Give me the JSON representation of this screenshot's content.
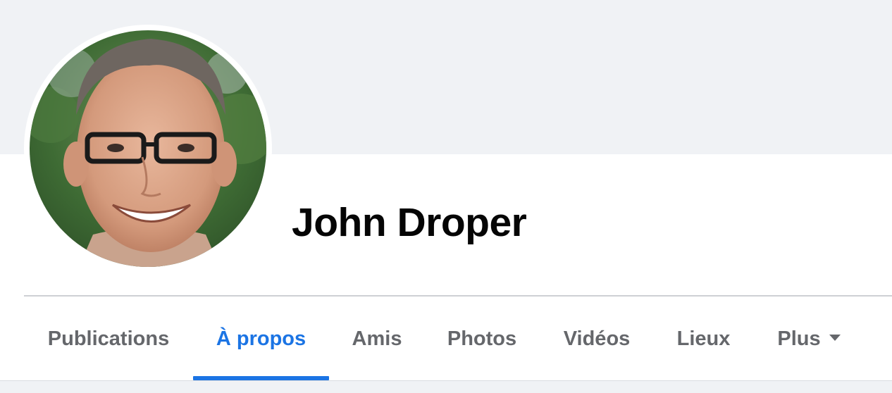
{
  "profile": {
    "name": "John Droper"
  },
  "tabs": [
    {
      "label": "Publications",
      "active": false
    },
    {
      "label": "À propos",
      "active": true
    },
    {
      "label": "Amis",
      "active": false
    },
    {
      "label": "Photos",
      "active": false
    },
    {
      "label": "Vidéos",
      "active": false
    },
    {
      "label": "Lieux",
      "active": false
    },
    {
      "label": "Plus",
      "active": false,
      "icon": "caret-down-icon"
    }
  ],
  "colors": {
    "accent": "#1b74e4",
    "cover_background": "#f0f2f5",
    "tab_text": "#65676b",
    "name_text": "#050505"
  }
}
